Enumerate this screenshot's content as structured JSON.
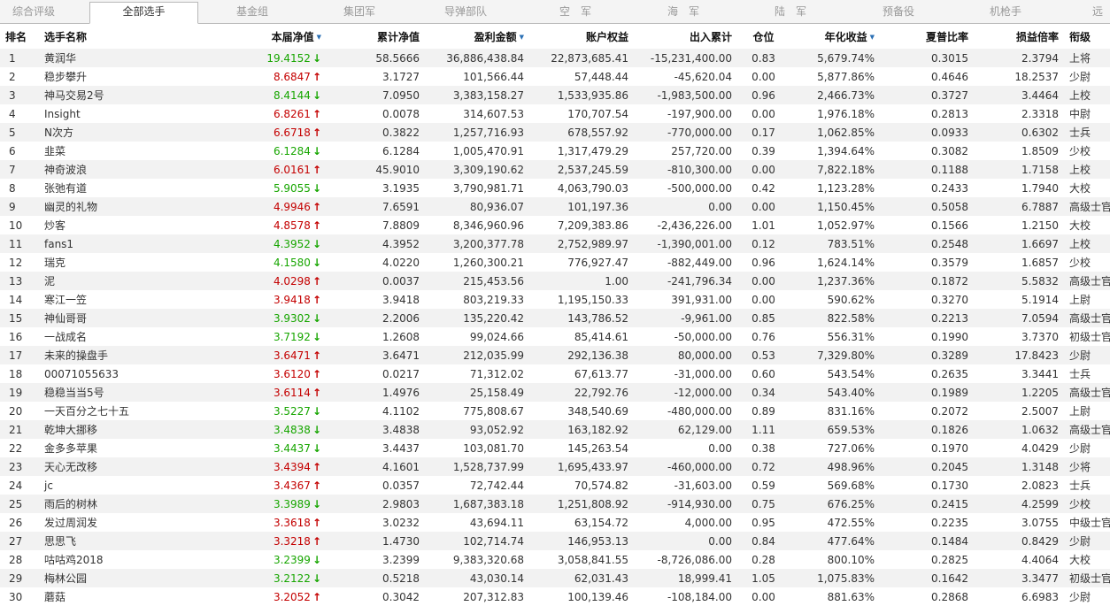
{
  "tabs": [
    "综合评级",
    "全部选手",
    "基金组",
    "集团军",
    "导弹部队",
    "空　军",
    "海　军",
    "陆　军",
    "预备役",
    "机枪手",
    "远"
  ],
  "active_tab_index": 1,
  "columns": [
    "排名",
    "选手名称",
    "本届净值",
    "累计净值",
    "盈利金额",
    "账户权益",
    "出入累计",
    "仓位",
    "年化收益",
    "夏普比率",
    "损益倍率",
    "衔级"
  ],
  "sort_icon": "▼",
  "colors": {
    "up": "#c40000",
    "down": "#17a600",
    "sort": "#2a6fb4"
  },
  "rows": [
    {
      "rank": "1",
      "name": "黄润华",
      "nav": "19.4152",
      "dir": "down",
      "cum_nav": "58.5666",
      "profit": "36,886,438.84",
      "equity": "22,873,685.41",
      "flow": "-15,231,400.00",
      "position": "0.83",
      "annual": "5,679.74%",
      "sharpe": "0.3015",
      "pl_ratio": "2.3794",
      "grade": "上将"
    },
    {
      "rank": "2",
      "name": "稳步攀升",
      "nav": "8.6847",
      "dir": "up",
      "cum_nav": "3.1727",
      "profit": "101,566.44",
      "equity": "57,448.44",
      "flow": "-45,620.04",
      "position": "0.00",
      "annual": "5,877.86%",
      "sharpe": "0.4646",
      "pl_ratio": "18.2537",
      "grade": "少尉"
    },
    {
      "rank": "3",
      "name": "神马交易2号",
      "nav": "8.4144",
      "dir": "down",
      "cum_nav": "7.0950",
      "profit": "3,383,158.27",
      "equity": "1,533,935.86",
      "flow": "-1,983,500.00",
      "position": "0.96",
      "annual": "2,466.73%",
      "sharpe": "0.3727",
      "pl_ratio": "3.4464",
      "grade": "上校"
    },
    {
      "rank": "4",
      "name": "Insight",
      "nav": "6.8261",
      "dir": "up",
      "cum_nav": "0.0078",
      "profit": "314,607.53",
      "equity": "170,707.54",
      "flow": "-197,900.00",
      "position": "0.00",
      "annual": "1,976.18%",
      "sharpe": "0.2813",
      "pl_ratio": "2.3318",
      "grade": "中尉"
    },
    {
      "rank": "5",
      "name": "N次方",
      "nav": "6.6718",
      "dir": "up",
      "cum_nav": "0.3822",
      "profit": "1,257,716.93",
      "equity": "678,557.92",
      "flow": "-770,000.00",
      "position": "0.17",
      "annual": "1,062.85%",
      "sharpe": "0.0933",
      "pl_ratio": "0.6302",
      "grade": "士兵"
    },
    {
      "rank": "6",
      "name": "韭菜",
      "nav": "6.1284",
      "dir": "down",
      "cum_nav": "6.1284",
      "profit": "1,005,470.91",
      "equity": "1,317,479.29",
      "flow": "257,720.00",
      "position": "0.39",
      "annual": "1,394.64%",
      "sharpe": "0.3082",
      "pl_ratio": "1.8509",
      "grade": "少校"
    },
    {
      "rank": "7",
      "name": "神奇波浪",
      "nav": "6.0161",
      "dir": "up",
      "cum_nav": "45.9010",
      "profit": "3,309,190.62",
      "equity": "2,537,245.59",
      "flow": "-810,300.00",
      "position": "0.00",
      "annual": "7,822.18%",
      "sharpe": "0.1188",
      "pl_ratio": "1.7158",
      "grade": "上校"
    },
    {
      "rank": "8",
      "name": "张弛有道",
      "nav": "5.9055",
      "dir": "down",
      "cum_nav": "3.1935",
      "profit": "3,790,981.71",
      "equity": "4,063,790.03",
      "flow": "-500,000.00",
      "position": "0.42",
      "annual": "1,123.28%",
      "sharpe": "0.2433",
      "pl_ratio": "1.7940",
      "grade": "大校"
    },
    {
      "rank": "9",
      "name": "幽灵的礼物",
      "nav": "4.9946",
      "dir": "up",
      "cum_nav": "7.6591",
      "profit": "80,936.07",
      "equity": "101,197.36",
      "flow": "0.00",
      "position": "0.00",
      "annual": "1,150.45%",
      "sharpe": "0.5058",
      "pl_ratio": "6.7887",
      "grade": "高级士官"
    },
    {
      "rank": "10",
      "name": "炒客",
      "nav": "4.8578",
      "dir": "up",
      "cum_nav": "7.8809",
      "profit": "8,346,960.96",
      "equity": "7,209,383.86",
      "flow": "-2,436,226.00",
      "position": "1.01",
      "annual": "1,052.97%",
      "sharpe": "0.1566",
      "pl_ratio": "1.2150",
      "grade": "大校"
    },
    {
      "rank": "11",
      "name": "fans1",
      "nav": "4.3952",
      "dir": "down",
      "cum_nav": "4.3952",
      "profit": "3,200,377.78",
      "equity": "2,752,989.97",
      "flow": "-1,390,001.00",
      "position": "0.12",
      "annual": "783.51%",
      "sharpe": "0.2548",
      "pl_ratio": "1.6697",
      "grade": "上校"
    },
    {
      "rank": "12",
      "name": "瑞克",
      "nav": "4.1580",
      "dir": "down",
      "cum_nav": "4.0220",
      "profit": "1,260,300.21",
      "equity": "776,927.47",
      "flow": "-882,449.00",
      "position": "0.96",
      "annual": "1,624.14%",
      "sharpe": "0.3579",
      "pl_ratio": "1.6857",
      "grade": "少校"
    },
    {
      "rank": "13",
      "name": "泥",
      "nav": "4.0298",
      "dir": "up",
      "cum_nav": "0.0037",
      "profit": "215,453.56",
      "equity": "1.00",
      "flow": "-241,796.34",
      "position": "0.00",
      "annual": "1,237.36%",
      "sharpe": "0.1872",
      "pl_ratio": "5.5832",
      "grade": "高级士官"
    },
    {
      "rank": "14",
      "name": "寒江一笠",
      "nav": "3.9418",
      "dir": "up",
      "cum_nav": "3.9418",
      "profit": "803,219.33",
      "equity": "1,195,150.33",
      "flow": "391,931.00",
      "position": "0.00",
      "annual": "590.62%",
      "sharpe": "0.3270",
      "pl_ratio": "5.1914",
      "grade": "上尉"
    },
    {
      "rank": "15",
      "name": "神仙哥哥",
      "nav": "3.9302",
      "dir": "down",
      "cum_nav": "2.2006",
      "profit": "135,220.42",
      "equity": "143,786.52",
      "flow": "-9,961.00",
      "position": "0.85",
      "annual": "822.58%",
      "sharpe": "0.2213",
      "pl_ratio": "7.0594",
      "grade": "高级士官"
    },
    {
      "rank": "16",
      "name": "一战成名",
      "nav": "3.7192",
      "dir": "down",
      "cum_nav": "1.2608",
      "profit": "99,024.66",
      "equity": "85,414.61",
      "flow": "-50,000.00",
      "position": "0.76",
      "annual": "556.31%",
      "sharpe": "0.1990",
      "pl_ratio": "3.7370",
      "grade": "初级士官"
    },
    {
      "rank": "17",
      "name": "未来的操盘手",
      "nav": "3.6471",
      "dir": "up",
      "cum_nav": "3.6471",
      "profit": "212,035.99",
      "equity": "292,136.38",
      "flow": "80,000.00",
      "position": "0.53",
      "annual": "7,329.80%",
      "sharpe": "0.3289",
      "pl_ratio": "17.8423",
      "grade": "少尉"
    },
    {
      "rank": "18",
      "name": "00071055633",
      "nav": "3.6120",
      "dir": "up",
      "cum_nav": "0.0217",
      "profit": "71,312.02",
      "equity": "67,613.77",
      "flow": "-31,000.00",
      "position": "0.60",
      "annual": "543.54%",
      "sharpe": "0.2635",
      "pl_ratio": "3.3441",
      "grade": "士兵"
    },
    {
      "rank": "19",
      "name": "稳稳当当5号",
      "nav": "3.6114",
      "dir": "up",
      "cum_nav": "1.4976",
      "profit": "25,158.49",
      "equity": "22,792.76",
      "flow": "-12,000.00",
      "position": "0.34",
      "annual": "543.40%",
      "sharpe": "0.1989",
      "pl_ratio": "1.2205",
      "grade": "高级士官"
    },
    {
      "rank": "20",
      "name": "一天百分之七十五",
      "nav": "3.5227",
      "dir": "down",
      "cum_nav": "4.1102",
      "profit": "775,808.67",
      "equity": "348,540.69",
      "flow": "-480,000.00",
      "position": "0.89",
      "annual": "831.16%",
      "sharpe": "0.2072",
      "pl_ratio": "2.5007",
      "grade": "上尉"
    },
    {
      "rank": "21",
      "name": "乾坤大挪移",
      "nav": "3.4838",
      "dir": "down",
      "cum_nav": "3.4838",
      "profit": "93,052.92",
      "equity": "163,182.92",
      "flow": "62,129.00",
      "position": "1.11",
      "annual": "659.53%",
      "sharpe": "0.1826",
      "pl_ratio": "1.0632",
      "grade": "高级士官"
    },
    {
      "rank": "22",
      "name": "金多多苹果",
      "nav": "3.4437",
      "dir": "down",
      "cum_nav": "3.4437",
      "profit": "103,081.70",
      "equity": "145,263.54",
      "flow": "0.00",
      "position": "0.38",
      "annual": "727.06%",
      "sharpe": "0.1970",
      "pl_ratio": "4.0429",
      "grade": "少尉"
    },
    {
      "rank": "23",
      "name": "天心无改移",
      "nav": "3.4394",
      "dir": "up",
      "cum_nav": "4.1601",
      "profit": "1,528,737.99",
      "equity": "1,695,433.97",
      "flow": "-460,000.00",
      "position": "0.72",
      "annual": "498.96%",
      "sharpe": "0.2045",
      "pl_ratio": "1.3148",
      "grade": "少将"
    },
    {
      "rank": "24",
      "name": "jc",
      "nav": "3.4367",
      "dir": "up",
      "cum_nav": "0.0357",
      "profit": "72,742.44",
      "equity": "70,574.82",
      "flow": "-31,603.00",
      "position": "0.59",
      "annual": "569.68%",
      "sharpe": "0.1730",
      "pl_ratio": "2.0823",
      "grade": "士兵"
    },
    {
      "rank": "25",
      "name": "雨后的树林",
      "nav": "3.3989",
      "dir": "down",
      "cum_nav": "2.9803",
      "profit": "1,687,383.18",
      "equity": "1,251,808.92",
      "flow": "-914,930.00",
      "position": "0.75",
      "annual": "676.25%",
      "sharpe": "0.2415",
      "pl_ratio": "4.2599",
      "grade": "少校"
    },
    {
      "rank": "26",
      "name": "发过周润发",
      "nav": "3.3618",
      "dir": "up",
      "cum_nav": "3.0232",
      "profit": "43,694.11",
      "equity": "63,154.72",
      "flow": "4,000.00",
      "position": "0.95",
      "annual": "472.55%",
      "sharpe": "0.2235",
      "pl_ratio": "3.0755",
      "grade": "中级士官"
    },
    {
      "rank": "27",
      "name": "思思飞",
      "nav": "3.3218",
      "dir": "up",
      "cum_nav": "1.4730",
      "profit": "102,714.74",
      "equity": "146,953.13",
      "flow": "0.00",
      "position": "0.84",
      "annual": "477.64%",
      "sharpe": "0.1484",
      "pl_ratio": "0.8429",
      "grade": "少尉"
    },
    {
      "rank": "28",
      "name": "咕咕鸡2018",
      "nav": "3.2399",
      "dir": "down",
      "cum_nav": "3.2399",
      "profit": "9,383,320.68",
      "equity": "3,058,841.55",
      "flow": "-8,726,086.00",
      "position": "0.28",
      "annual": "800.10%",
      "sharpe": "0.2825",
      "pl_ratio": "4.4064",
      "grade": "大校"
    },
    {
      "rank": "29",
      "name": "梅林公园",
      "nav": "3.2122",
      "dir": "down",
      "cum_nav": "0.5218",
      "profit": "43,030.14",
      "equity": "62,031.43",
      "flow": "18,999.41",
      "position": "1.05",
      "annual": "1,075.83%",
      "sharpe": "0.1642",
      "pl_ratio": "3.3477",
      "grade": "初级士官"
    },
    {
      "rank": "30",
      "name": "蘑菇",
      "nav": "3.2052",
      "dir": "up",
      "cum_nav": "0.3042",
      "profit": "207,312.83",
      "equity": "100,139.46",
      "flow": "-108,184.00",
      "position": "0.00",
      "annual": "881.63%",
      "sharpe": "0.2868",
      "pl_ratio": "6.6983",
      "grade": "少尉"
    }
  ]
}
